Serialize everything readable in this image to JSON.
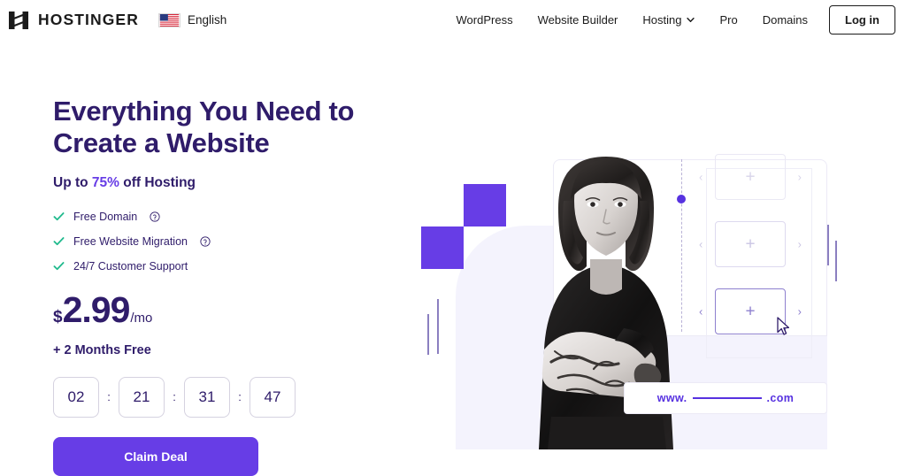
{
  "header": {
    "brand_name": "HOSTINGER",
    "logo_icon": "hostinger-h-logo",
    "language": {
      "label": "English",
      "flag_icon": "us-flag-icon"
    },
    "nav_items": [
      {
        "label": "WordPress",
        "has_chevron": false
      },
      {
        "label": "Website Builder",
        "has_chevron": false
      },
      {
        "label": "Hosting",
        "has_chevron": true
      },
      {
        "label": "Pro",
        "has_chevron": false
      },
      {
        "label": "Domains",
        "has_chevron": false
      }
    ],
    "login_label": "Log in"
  },
  "hero": {
    "heading_line1": "Everything You Need to",
    "heading_line2": "Create a Website",
    "subtitle_prefix": "Up to ",
    "subtitle_percent": "75%",
    "subtitle_suffix": " off Hosting",
    "features": [
      {
        "label": "Free Domain",
        "check_icon": "check-icon",
        "help_icon": "help-circle-icon",
        "has_help": true
      },
      {
        "label": "Free Website Migration",
        "check_icon": "check-icon",
        "help_icon": "help-circle-icon",
        "has_help": true
      },
      {
        "label": "24/7 Customer Support",
        "check_icon": "check-icon",
        "has_help": false
      }
    ],
    "price": {
      "currency": "$",
      "amount": "2.99",
      "period": "/mo"
    },
    "bonus": "+ 2 Months Free",
    "timer": {
      "days": "02",
      "hours": "21",
      "minutes": "31",
      "seconds": "47",
      "separator": ":"
    },
    "cta_label": "Claim Deal"
  },
  "illustration": {
    "url_prefix": "www.",
    "url_suffix": ".com",
    "card_plus": "+",
    "arrow_left": "‹",
    "arrow_right": "›",
    "cursor_icon": "mouse-pointer-icon",
    "photo_alt": "woman-portrait-photo"
  },
  "colors": {
    "accent_purple": "#673de6",
    "heading_indigo": "#2f1c6a",
    "check_green": "#20ba8d",
    "lavender_panel": "#f4f3fd",
    "url_purple": "#5732e0"
  }
}
